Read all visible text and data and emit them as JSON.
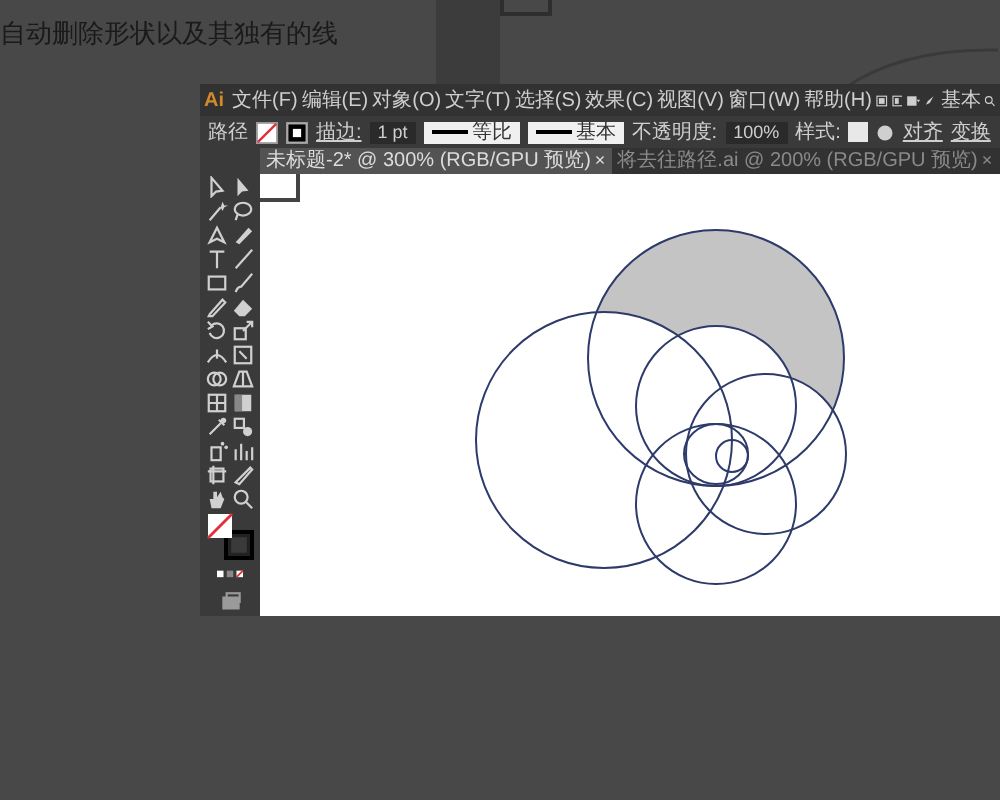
{
  "caption": "自动删除形状以及其独有的线",
  "app": {
    "logo": "Ai",
    "menu": [
      "文件(F)",
      "编辑(E)",
      "对象(O)",
      "文字(T)",
      "选择(S)",
      "效果(C)",
      "视图(V)",
      "窗口(W)",
      "帮助(H)"
    ],
    "workspace": "基本",
    "control_bar": {
      "selection": "路径",
      "stroke_label": "描边:",
      "stroke_weight": "1 pt",
      "profile": "等比",
      "brush": "基本",
      "opacity_label": "不透明度:",
      "opacity": "100%",
      "style_label": "样式:",
      "links": [
        "对齐",
        "变换"
      ]
    },
    "tabs": [
      {
        "label": "未标题-2* @ 300% (RGB/GPU 预览)",
        "close": "×",
        "selected": true
      },
      {
        "label": "将去往路径.ai @ 200% (RGB/GPU 预览)",
        "close": "×",
        "selected": false
      }
    ]
  }
}
